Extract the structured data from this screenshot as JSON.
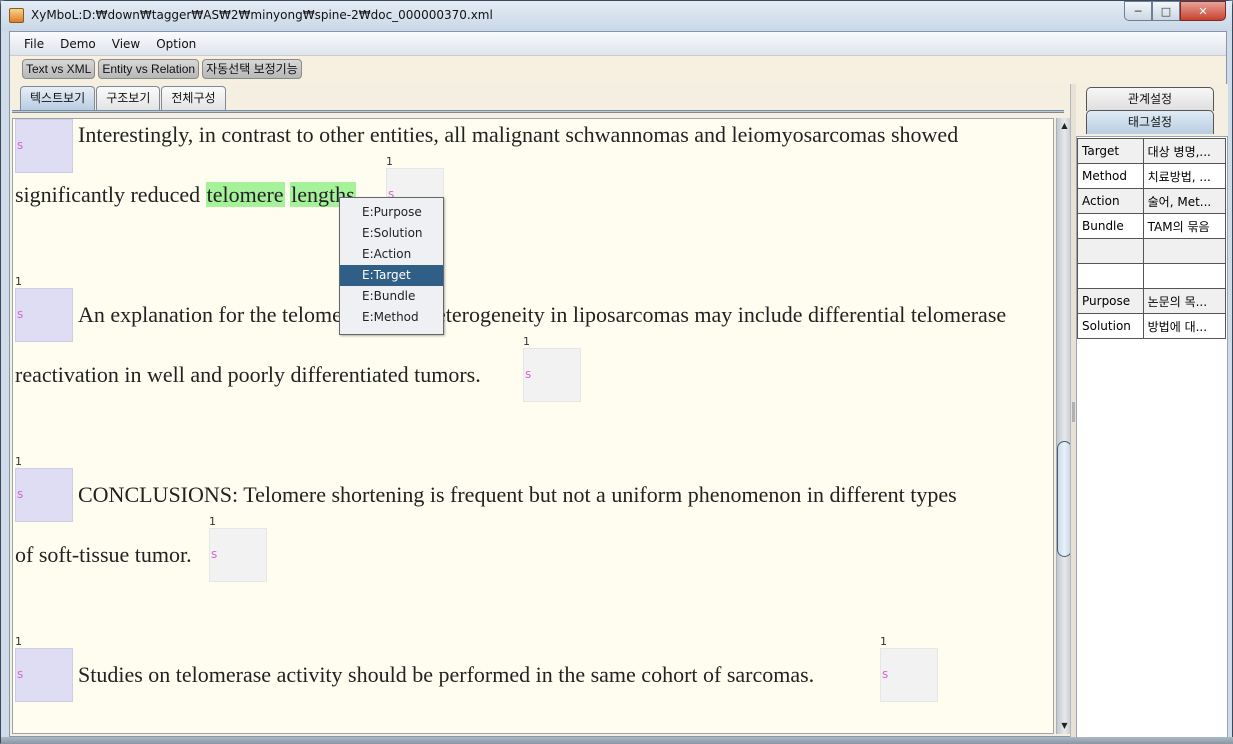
{
  "window": {
    "title": "XyMboL:D:₩down₩tagger₩AS₩2₩minyong₩spine-2₩doc_000000370.xml",
    "controls": [
      "minimize",
      "maximize",
      "close"
    ]
  },
  "menubar": {
    "items": [
      "File",
      "Demo",
      "View",
      "Option"
    ]
  },
  "toolbar": {
    "buttons": [
      "Text vs XML",
      "Entity vs Relation",
      "자동선택 보정기능"
    ]
  },
  "left_tabs": [
    {
      "label": "텍스트보기",
      "active": true
    },
    {
      "label": "구조보기",
      "active": false
    },
    {
      "label": "전체구성",
      "active": false
    }
  ],
  "document": {
    "marker_letter": "s",
    "marker_count": "1",
    "lines": [
      "Interestingly, in contrast to other entities, all malignant schwannomas and leiomyosarcomas showed",
      "significantly reduced ",
      "An explanation for the telomere length heterogeneity in liposarcomas may include differential telomerase",
      "reactivation in well and poorly differentiated tumors.",
      "CONCLUSIONS: Telomere shortening is frequent but not a uniform phenomenon in different types",
      "of soft-tissue tumor.",
      "Studies on telomerase activity should be performed in the same cohort of sarcomas."
    ],
    "highlighted": [
      "telomere",
      "lengths"
    ],
    "highlight_color": "#a6f29b"
  },
  "context_menu": {
    "items": [
      "E:Purpose",
      "E:Solution",
      "E:Action",
      "E:Target",
      "E:Bundle",
      "E:Method"
    ],
    "selected": "E:Target",
    "selected_color": "#2f5f86"
  },
  "right_tabs": [
    {
      "label": "관계설정",
      "active": false
    },
    {
      "label": "태그설정",
      "active": true
    }
  ],
  "tag_table": {
    "rows": [
      {
        "name": "Target",
        "desc": "대상 병명,..."
      },
      {
        "name": "Method",
        "desc": "치료방법, ..."
      },
      {
        "name": "Action",
        "desc": "술어, Met..."
      },
      {
        "name": "Bundle",
        "desc": "TAM의 묶음"
      },
      {
        "name": "",
        "desc": ""
      },
      {
        "name": "",
        "desc": ""
      },
      {
        "name": "Purpose",
        "desc": "논문의 목..."
      },
      {
        "name": "Solution",
        "desc": "방법에 대..."
      }
    ]
  }
}
